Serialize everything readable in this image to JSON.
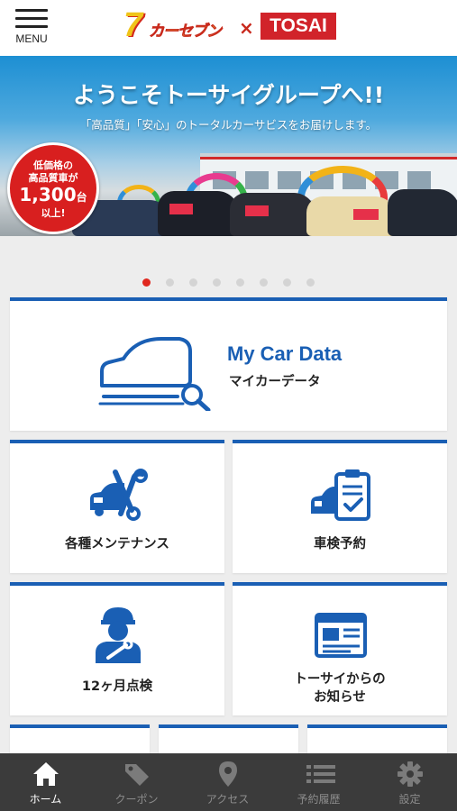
{
  "header": {
    "menu_label": "MENU",
    "logo_left_text": "カーセブン",
    "logo_cross": "×",
    "logo_right_text": "TOSAI"
  },
  "banner": {
    "title": "ようこそトーサイグループへ!!",
    "subtitle": "「高品質」「安心」のトータルカーサビスをお届けします。",
    "badge_line1": "低価格の",
    "badge_line2": "高品質車が",
    "badge_count": "1,300",
    "badge_unit": "台",
    "badge_line4": "以上!"
  },
  "carousel": {
    "total": 8,
    "active_index": 0
  },
  "cards": {
    "mycar_title": "My Car Data",
    "mycar_sub": "マイカーデータ",
    "maintenance": "各種メンテナンス",
    "inspection_booking": "車検予約",
    "twelve_month": "12ヶ月点検",
    "news_line1": "トーサイからの",
    "news_line2": "お知らせ"
  },
  "bottom_nav": [
    {
      "label": "ホーム",
      "icon": "home-icon",
      "active": true
    },
    {
      "label": "クーポン",
      "icon": "coupon-tag-icon",
      "active": false
    },
    {
      "label": "アクセス",
      "icon": "map-pin-icon",
      "active": false
    },
    {
      "label": "予約履歴",
      "icon": "list-icon",
      "active": false
    },
    {
      "label": "設定",
      "icon": "gear-icon",
      "active": false
    }
  ],
  "colors": {
    "accent_blue": "#1a5fb4",
    "brand_red": "#d1232a",
    "nav_bg": "#3b3b3b",
    "active_dot": "#e0281f"
  }
}
